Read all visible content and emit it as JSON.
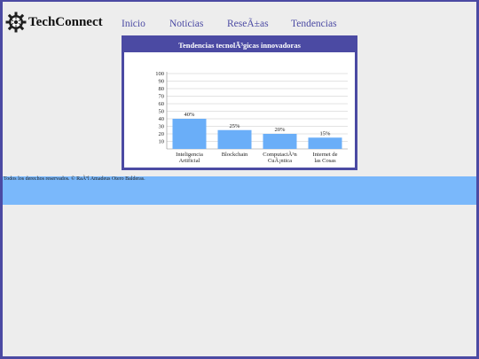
{
  "brand": {
    "name": "TechConnect",
    "logo_icon": "gear-icon"
  },
  "nav": {
    "items": [
      {
        "label": "Inicio"
      },
      {
        "label": "Noticias"
      },
      {
        "label": "ReseÃ±as"
      },
      {
        "label": "Tendencias"
      }
    ]
  },
  "colors": {
    "accent": "#4b4aa3",
    "bar": "#6aaef8",
    "footer": "#7ab8fb",
    "background": "#ededed"
  },
  "chart_data": {
    "type": "bar",
    "title": "Tendencias tecnolÃ³gicas innovadoras",
    "categories": [
      [
        "Inteligencia",
        "Artificial"
      ],
      [
        "Blockchain"
      ],
      [
        "ComputaciÃ³n",
        "CuÃ¡ntica"
      ],
      [
        "Internet de",
        "las Cosas"
      ]
    ],
    "values": [
      40,
      25,
      20,
      15
    ],
    "data_labels": [
      "40%",
      "25%",
      "20%",
      "15%"
    ],
    "y_ticks": [
      "100",
      "90",
      "80",
      "70",
      "60",
      "50",
      "40",
      "30",
      "20",
      "10"
    ],
    "ylim": [
      0,
      100
    ],
    "grid": true,
    "xlabel": "",
    "ylabel": ""
  },
  "footer": {
    "text": "Todos los derechos reservados. © RaÃºl Amadeus Otero Balderas."
  }
}
